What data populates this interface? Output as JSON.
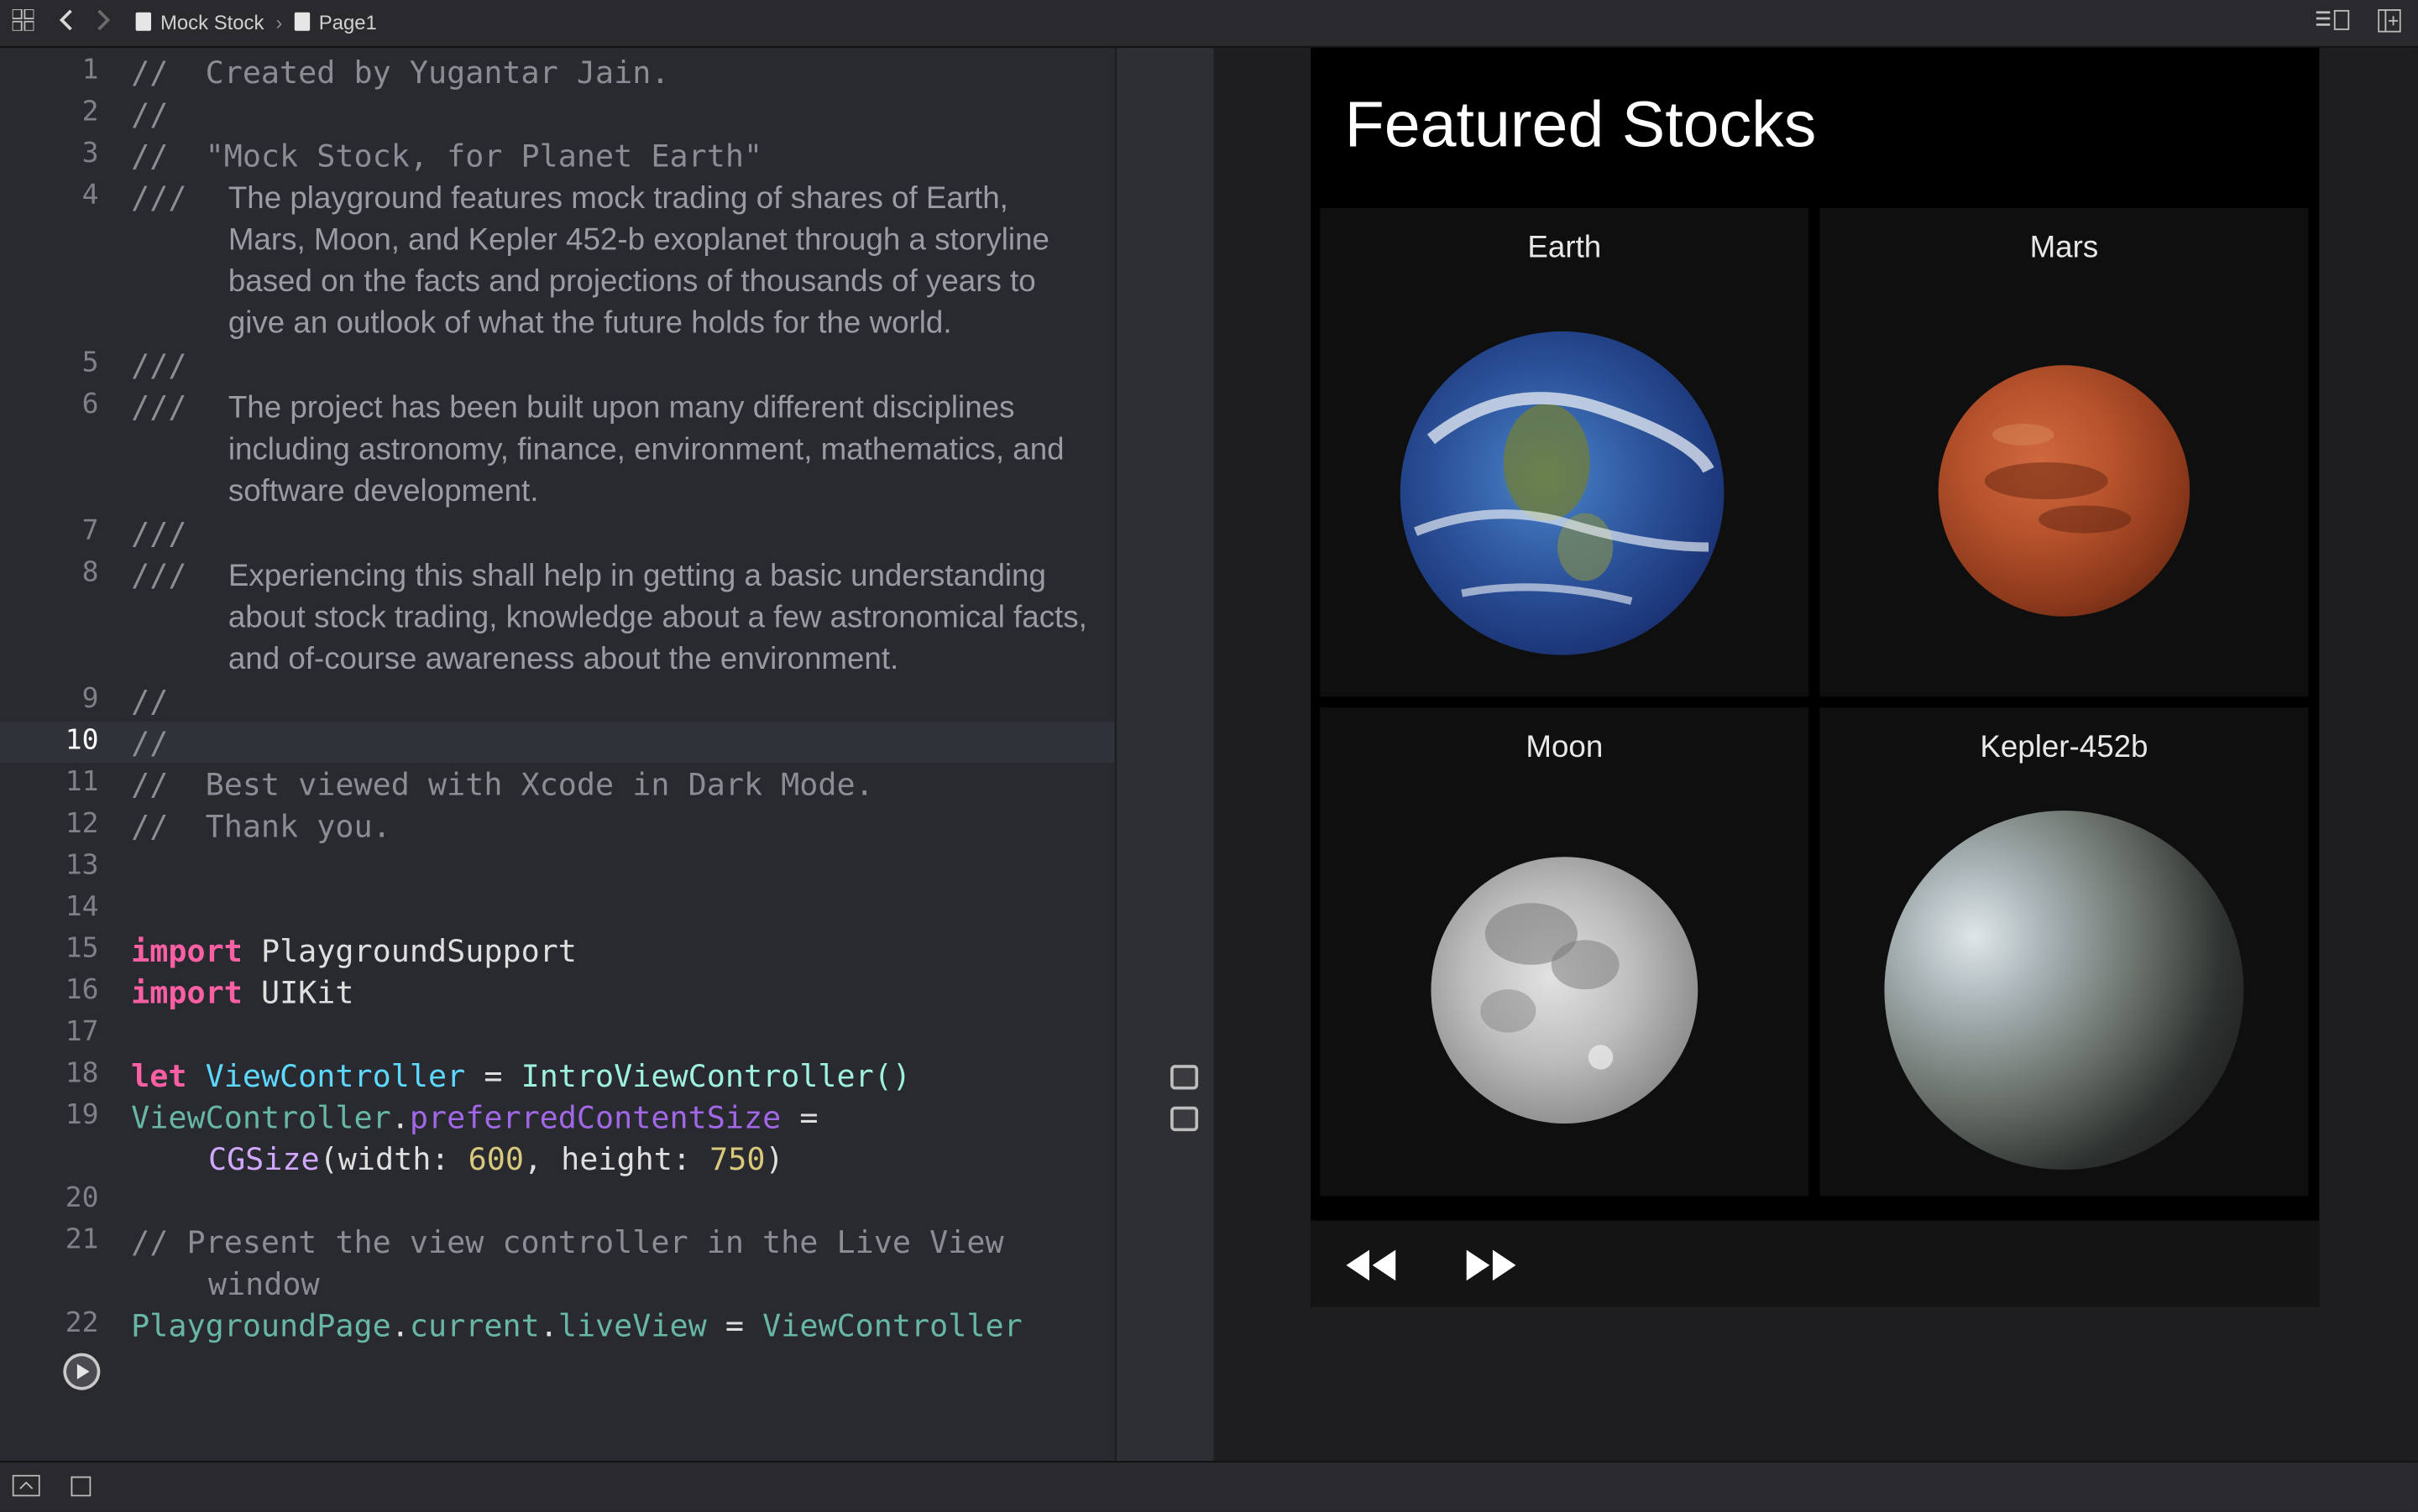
{
  "breadcrumb": {
    "project": "Mock Stock",
    "page": "Page1",
    "separator": "›"
  },
  "editor": {
    "lines": [
      {
        "n": "1",
        "text": "//  Created by Yugantar Jain."
      },
      {
        "n": "2",
        "text": "//"
      },
      {
        "n": "3",
        "text": "//  \"Mock Stock, for Planet Earth\""
      },
      {
        "n": "4",
        "prefix": "///",
        "text": "The playground features mock trading of shares of Earth, Mars, Moon, and Kepler 452-b exoplanet through a storyline based on the facts and projections of thousands of years to give an outlook of what the future holds for the world."
      },
      {
        "n": "5",
        "text": "///"
      },
      {
        "n": "6",
        "prefix": "///",
        "text": "The project has been built upon many different disciplines including astronomy, finance, environment, mathematics, and software development."
      },
      {
        "n": "7",
        "text": "///"
      },
      {
        "n": "8",
        "prefix": "///",
        "text": "Experiencing this shall help in getting a basic understanding about stock trading, knowledge about a few astronomical facts, and of-course awareness about the environment."
      },
      {
        "n": "9",
        "text": "//"
      },
      {
        "n": "10",
        "text": "//"
      },
      {
        "n": "11",
        "text": "//  Best viewed with Xcode in Dark Mode."
      },
      {
        "n": "12",
        "text": "//  Thank you."
      },
      {
        "n": "13",
        "text": ""
      },
      {
        "n": "14",
        "text": ""
      },
      {
        "n": "15",
        "kw": "import",
        "rest": "PlaygroundSupport"
      },
      {
        "n": "16",
        "kw": "import",
        "rest": "UIKit"
      },
      {
        "n": "17",
        "text": ""
      },
      {
        "n": "18",
        "kw": "let",
        "var": "ViewController",
        "op": " = ",
        "call": "IntroViewController()"
      },
      {
        "n": "19",
        "obj": "ViewController",
        "dot": ".",
        "prop": "preferredContentSize",
        "op": " ="
      },
      {
        "n": "19b",
        "type": "CGSize",
        "args1": "(width: ",
        "w": "600",
        "args2": ", height: ",
        "h": "750",
        "args3": ")"
      },
      {
        "n": "20",
        "text": ""
      },
      {
        "n": "21",
        "text": "// Present the view controller in the Live View"
      },
      {
        "n": "21b",
        "text": "window"
      },
      {
        "n": "22",
        "obj": "PlaygroundPage",
        "p1": "current",
        "p2": "liveView",
        "op": " = ",
        "val": "ViewController"
      }
    ]
  },
  "live_view": {
    "title": "Featured Stocks",
    "cards": [
      {
        "name": "Earth"
      },
      {
        "name": "Mars"
      },
      {
        "name": "Moon"
      },
      {
        "name": "Kepler-452b"
      }
    ]
  }
}
